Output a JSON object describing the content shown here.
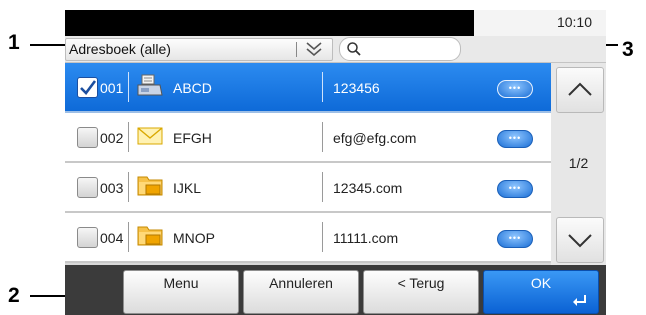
{
  "callouts": {
    "c1": "1",
    "c2": "2",
    "c3": "3"
  },
  "status": {
    "time": "10:10"
  },
  "address_book": {
    "selected": "Adresboek (alle)"
  },
  "search": {
    "placeholder": ""
  },
  "rows": [
    {
      "number": "001",
      "name": "ABCD",
      "address": "123456",
      "type": "fax-icon",
      "checked": true
    },
    {
      "number": "002",
      "name": "EFGH",
      "address": "efg@efg.com",
      "type": "email-icon",
      "checked": false
    },
    {
      "number": "003",
      "name": "IJKL",
      "address": "12345.com",
      "type": "folder-icon",
      "checked": false
    },
    {
      "number": "004",
      "name": "MNOP",
      "address": "11111.com",
      "type": "folder-icon",
      "checked": false
    }
  ],
  "pager": {
    "label": "1/2"
  },
  "buttons": {
    "menu": "Menu",
    "cancel": "Annuleren",
    "back": "< Terug",
    "ok": "OK"
  },
  "colors": {
    "selected_row": "#1a7be6",
    "ok_button": "#1a7be6",
    "status_bar": "#000000",
    "bottom_bar": "#3b3b3b"
  }
}
